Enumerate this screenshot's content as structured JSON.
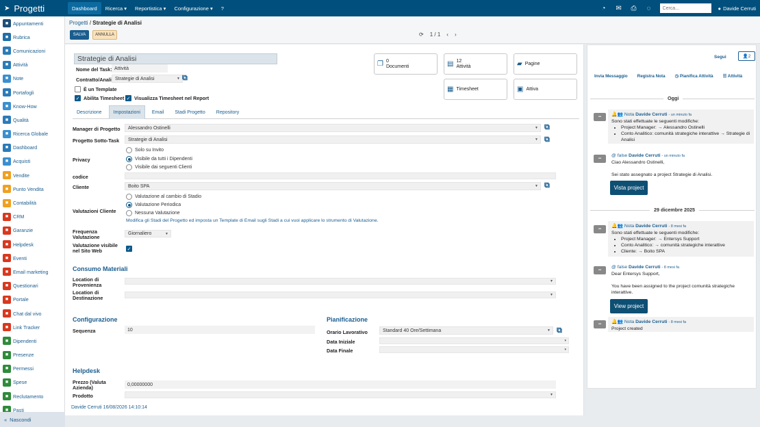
{
  "topbar": {
    "brand": "Progetti",
    "nav": [
      "Dashboard",
      "Ricerca ▾",
      "Reportistica ▾",
      "Configurazione ▾",
      "?"
    ],
    "search_placeholder": "Cerca...",
    "user": "Davide Cerruti"
  },
  "sidebar": {
    "items": [
      {
        "label": "Appuntamenti",
        "color": "#1f4e79",
        "icon": "calendar-icon"
      },
      {
        "label": "Rubrica",
        "color": "#1f6fa8",
        "icon": "address-book-icon"
      },
      {
        "label": "Comunicazioni",
        "color": "#2b7bb9",
        "icon": "mail-icon"
      },
      {
        "label": "Attività",
        "color": "#2b7bb9",
        "icon": "tasks-icon"
      },
      {
        "label": "Note",
        "color": "#3a8fd0",
        "icon": "note-icon"
      },
      {
        "label": "Portafogli",
        "color": "#2b7bb9",
        "icon": "portfolio-icon"
      },
      {
        "label": "Know-How",
        "color": "#3a8fd0",
        "icon": "knowhow-icon"
      },
      {
        "label": "Qualità",
        "color": "#2b7bb9",
        "icon": "quality-icon"
      },
      {
        "label": "Ricerca Globale",
        "color": "#3a8fd0",
        "icon": "search-icon"
      },
      {
        "label": "Dashboard",
        "color": "#2b7bb9",
        "icon": "dashboard-icon"
      },
      {
        "label": "Acquisti",
        "color": "#3a8fd0",
        "icon": "cart-icon"
      },
      {
        "label": "Vendite",
        "color": "#f0a020",
        "icon": "sales-icon"
      },
      {
        "label": "Punto Vendita",
        "color": "#f0a020",
        "icon": "store-icon"
      },
      {
        "label": "Contabilità",
        "color": "#f0a020",
        "icon": "accounting-icon"
      },
      {
        "label": "CRM",
        "color": "#d9381e",
        "icon": "crm-icon"
      },
      {
        "label": "Garanzie",
        "color": "#d9381e",
        "icon": "warranty-icon"
      },
      {
        "label": "Helpdesk",
        "color": "#d9381e",
        "icon": "helpdesk-icon"
      },
      {
        "label": "Eventi",
        "color": "#d9381e",
        "icon": "events-icon"
      },
      {
        "label": "Email marketing",
        "color": "#d9381e",
        "icon": "email-marketing-icon"
      },
      {
        "label": "Questionari",
        "color": "#d9381e",
        "icon": "survey-icon"
      },
      {
        "label": "Portale",
        "color": "#d9381e",
        "icon": "portal-icon"
      },
      {
        "label": "Chat dal vivo",
        "color": "#d9381e",
        "icon": "chat-icon"
      },
      {
        "label": "Link Tracker",
        "color": "#d9381e",
        "icon": "link-icon"
      },
      {
        "label": "Dipendenti",
        "color": "#2e8b3a",
        "icon": "employees-icon"
      },
      {
        "label": "Presenze",
        "color": "#2e8b3a",
        "icon": "attendance-icon"
      },
      {
        "label": "Permessi",
        "color": "#2e8b3a",
        "icon": "leave-icon"
      },
      {
        "label": "Spese",
        "color": "#2e8b3a",
        "icon": "expenses-icon"
      },
      {
        "label": "Reclutamento",
        "color": "#2e8b3a",
        "icon": "recruit-icon"
      },
      {
        "label": "Pasti",
        "color": "#2e8b3a",
        "icon": "meals-icon"
      }
    ],
    "hide_label": "Nascondi"
  },
  "header": {
    "breadcrumb_root": "Progetti",
    "breadcrumb_sep": "/",
    "breadcrumb_current": "Strategie di Analisi",
    "save_label": "SALVA",
    "cancel_label": "ANNULLA",
    "pager": "1 / 1"
  },
  "form": {
    "title": "Strategie di Analisi",
    "task_name_label": "Nome del Task:",
    "task_name_value": "Attività",
    "contract_label": "Contratto/Analitica",
    "contract_value": "Strategie di Analisi",
    "is_template_label": "È un Template",
    "timesheet_label": "Abilita Timesheet",
    "timesheet_report_label": "Visualizza Timesheet nel Report",
    "cards": {
      "documents_count": "0",
      "documents_label": "Documenti",
      "activities_count": "12",
      "activities_label": "Attività",
      "pages_label": "Pagine",
      "timesheet_label": "Timesheet",
      "active_label": "Attiva"
    },
    "tabs": [
      "Descrizione",
      "Impostazioni",
      "Email",
      "Stadi Progetto",
      "Repository"
    ],
    "manager_label": "Manager di Progetto",
    "manager_value": "Alessandro Ostinelli",
    "subtask_label": "Progetto Sotto-Task",
    "subtask_value": "Strategie di Analisi",
    "privacy_label": "Privacy",
    "privacy_options": [
      "Solo su Invito",
      "Visibile da tutti i Dipendenti",
      "Visibile dai seguenti Clienti"
    ],
    "codice_label": "codice",
    "cliente_label": "Cliente",
    "cliente_value": "Boito SPA",
    "valutazioni_label": "Valutazioni Cliente",
    "valutazioni_options": [
      "Valutazione al cambio di Stadio",
      "Valutazione Periodica",
      "Nessuna Valutazione"
    ],
    "valutazioni_info": "Modifica gli Stadi del Progetto ed imposta un Template di Email sugli Stadi a cui vuoi applicare lo strumento di Valutazione.",
    "frequenza_label_1": "Frequenza",
    "frequenza_label_2": "Valutazione",
    "frequenza_value": "Giornaliero",
    "visibile_label_1": "Valutazione visibile",
    "visibile_label_2": "nel Sito Web",
    "consumo_title": "Consumo Materiali",
    "location_prov_1": "Location di",
    "location_prov_2": "Provenienza",
    "location_dest_1": "Location di",
    "location_dest_2": "Destinazione",
    "config_title": "Configurazione",
    "sequenza_label": "Sequenza",
    "sequenza_value": "10",
    "pianificazione_title": "Pianificazione",
    "orario_label": "Orario Lavorativo",
    "orario_value": "Standard 40 Ore/Settimana",
    "data_iniziale_label": "Data Iniziale",
    "data_finale_label": "Data Finale",
    "helpdesk_title": "Helpdesk",
    "prezzo_label_1": "Prezzo (Valuta",
    "prezzo_label_2": "Azienda)",
    "prezzo_value": "0,00000000",
    "prodotto_label": "Prodotto",
    "footer": "Davide Cerruti 16/08/2026 14:10:14"
  },
  "chatter": {
    "followers_label": "Segui",
    "followers_count": "2",
    "actions": [
      "Invia Messaggio",
      "Registra Nota",
      "Pianifica Attività",
      "Attività"
    ],
    "today_label": "Oggi",
    "date2_label": "29 dicembre 2025",
    "messages": [
      {
        "kind": "Nota",
        "author": "Davide Cerruti",
        "time": "- un minuto fa",
        "intro": "Sono stati effettuate le seguenti modifiche:",
        "changes": [
          "Project Manager: → Alessandro Ostinelli",
          "Conto Analitico: comunità strategiche interattive → Strategie di Analisi"
        ]
      },
      {
        "kind": "false",
        "author": "Davide Cerruti",
        "time": "- un minuto fa",
        "greeting": "Ciao Alessandro Ostinelli,",
        "body": "Sei stato assegnato a project Strategie di Analisi.",
        "button": "Vista project"
      },
      {
        "kind": "Nota",
        "author": "Davide Cerruti",
        "time": "- 8 mesi fa",
        "intro": "Sono stati effettuate le seguenti modifiche:",
        "changes": [
          "Project Manager: → Entersys Support",
          "Conto Analitico: → comunità strategiche interattive",
          "Cliente: → Boito SPA"
        ]
      },
      {
        "kind": "false",
        "author": "Davide Cerruti",
        "time": "- 8 mesi fa",
        "greeting": "Dear Entersys Support,",
        "body": "You have been assigned to the project comunità strategiche interattive.",
        "button": "View project"
      },
      {
        "kind": "Nota",
        "author": "Davide Cerruti",
        "time": "- 8 mesi fa",
        "intro": "Project created"
      }
    ]
  }
}
